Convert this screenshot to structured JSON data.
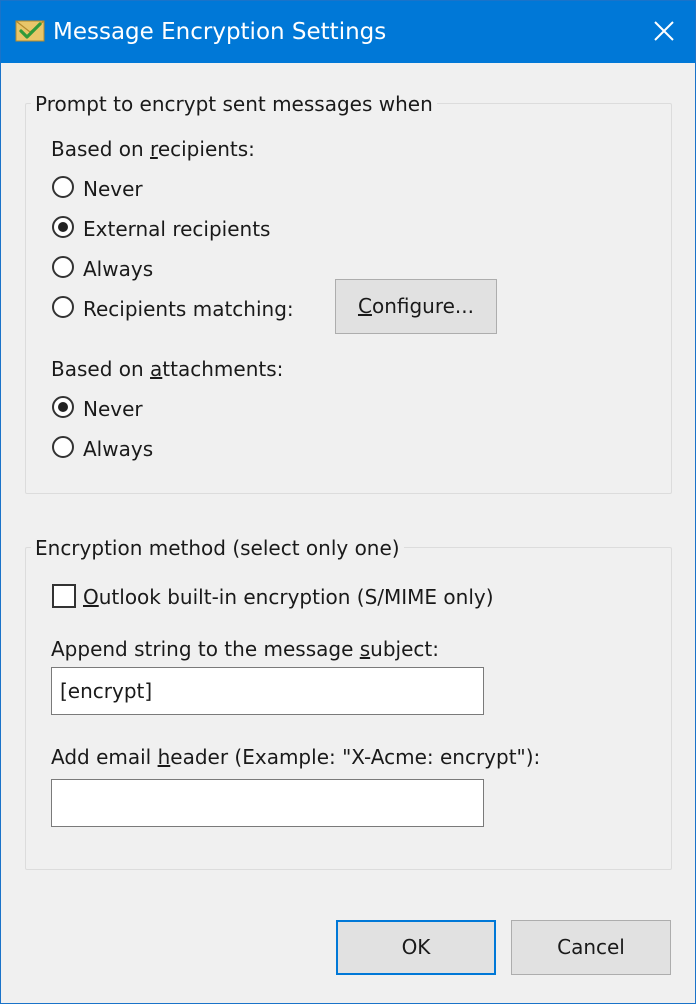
{
  "window": {
    "title": "Message Encryption Settings"
  },
  "prompt_group": {
    "label": "Prompt to encrypt sent messages when",
    "recipients": {
      "label_pre": "Based on ",
      "label_accel": "r",
      "label_post": "ecipients:",
      "options": [
        "Never",
        "External recipients",
        "Always",
        "Recipients matching:"
      ],
      "selected": "External recipients"
    },
    "configure": {
      "label_accel": "C",
      "label_post": "onfigure..."
    },
    "attachments": {
      "label_pre": "Based on ",
      "label_accel": "a",
      "label_post": "ttachments:",
      "options": [
        "Never",
        "Always"
      ],
      "selected": "Never"
    }
  },
  "method_group": {
    "label": "Encryption method (select only one)",
    "outlook_checkbox": {
      "label_accel": "O",
      "label_post": "utlook built-in encryption (S/MIME only)",
      "checked": false
    },
    "subject": {
      "label_pre": "Append string to the message ",
      "label_accel": "s",
      "label_post": "ubject:",
      "value": "[encrypt]"
    },
    "header": {
      "label_pre": "Add email ",
      "label_accel": "h",
      "label_post": "eader (Example: \"X-Acme: encrypt\"):",
      "value": ""
    }
  },
  "buttons": {
    "ok": "OK",
    "cancel": "Cancel"
  },
  "colors": {
    "titlebar": "#0078d7",
    "dialog_bg": "#f0f0f0",
    "default_button_border": "#0078d7"
  },
  "icons": {
    "title": "envelope-check-icon",
    "close": "close-icon"
  }
}
